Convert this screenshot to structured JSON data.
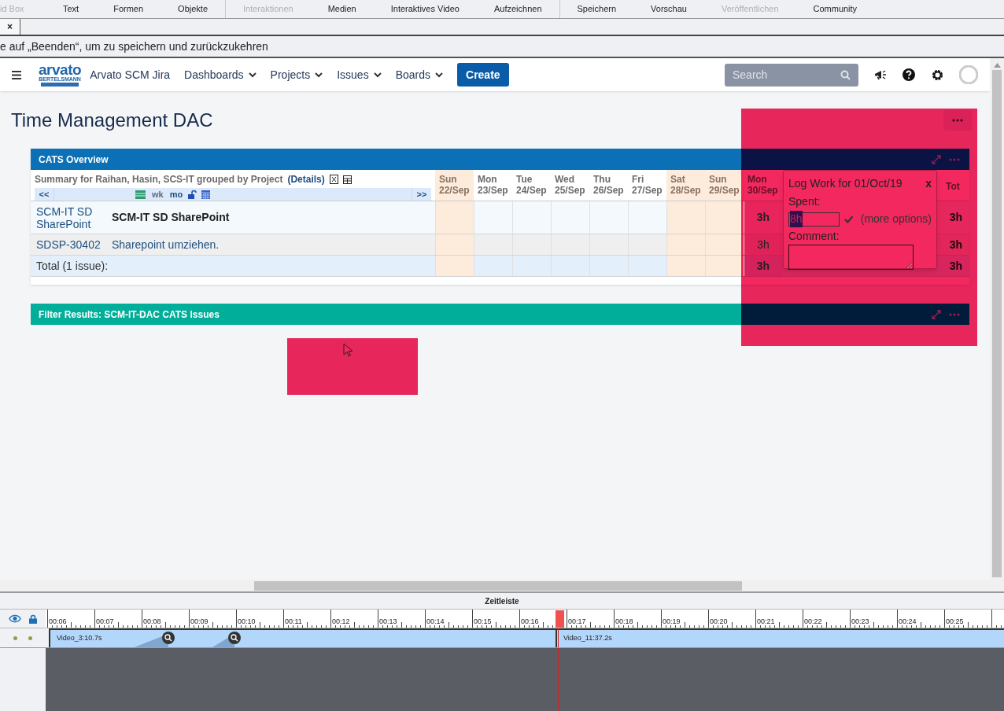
{
  "toolbar": {
    "groups": [
      [
        {
          "label": "id Box",
          "disabled": true
        },
        {
          "label": "Text",
          "disabled": false
        },
        {
          "label": "Formen",
          "disabled": false
        },
        {
          "label": "Objekte",
          "disabled": false
        }
      ],
      [
        {
          "label": "Interaktionen",
          "disabled": true
        },
        {
          "label": "Medien",
          "disabled": false
        },
        {
          "label": "Interaktives Video",
          "disabled": false
        },
        {
          "label": "Aufzeichnen",
          "disabled": false
        }
      ],
      [
        {
          "label": "Speichern",
          "disabled": false
        },
        {
          "label": "Vorschau",
          "disabled": false
        },
        {
          "label": "Veröffentlichen",
          "disabled": true
        },
        {
          "label": "Community",
          "disabled": false
        }
      ]
    ]
  },
  "document_tab": {
    "close": "×"
  },
  "message": "e auf „Beenden“, um zu speichern und zurückzukehren",
  "jira": {
    "header": {
      "logo_main": "arvato",
      "logo_sub": "BERTELSMANN",
      "site": "Arvato SCM Jira",
      "nav": [
        "Dashboards",
        "Projects",
        "Issues",
        "Boards"
      ],
      "create": "Create",
      "search_placeholder": "Search"
    },
    "page_title": "Time Management DAC",
    "cats": {
      "title": "CATS Overview",
      "summary": "Summary for Raihan, Hasin, SCS-IT grouped by Project",
      "details": "(Details)",
      "prev": "<<",
      "wk": "wk",
      "mo": "mo",
      "next": ">>",
      "days": [
        {
          "dow": "Sun",
          "date": "22/Sep",
          "weekend": true
        },
        {
          "dow": "Mon",
          "date": "23/Sep",
          "weekend": false
        },
        {
          "dow": "Tue",
          "date": "24/Sep",
          "weekend": false
        },
        {
          "dow": "Wed",
          "date": "25/Sep",
          "weekend": false
        },
        {
          "dow": "Thu",
          "date": "26/Sep",
          "weekend": false
        },
        {
          "dow": "Fri",
          "date": "27/Sep",
          "weekend": false
        },
        {
          "dow": "Sat",
          "date": "28/Sep",
          "weekend": true
        },
        {
          "dow": "Sun",
          "date": "29/Sep",
          "weekend": true
        },
        {
          "dow": "Mon",
          "date": "30/Sep",
          "weekend": false
        }
      ],
      "total_header": "Tot",
      "rows": [
        {
          "kind": "project",
          "key": "SCM-IT SD SharePoint",
          "summary": "SCM-IT SD SharePoint",
          "hours": {
            "8": "3h"
          },
          "total": "3h"
        },
        {
          "kind": "issue",
          "key": "SDSP-30402",
          "summary": "Sharepoint umziehen.",
          "hours": {
            "8": "3h"
          },
          "total": "3h"
        },
        {
          "kind": "total",
          "key": "Total (1 issue):",
          "hours": {
            "8": "3h"
          },
          "total": "3h"
        }
      ]
    },
    "popup": {
      "title": "Log Work for 01/Oct/19",
      "close": "x",
      "spent_label": "Spent:",
      "spent_value": "8h",
      "value_selected": true,
      "more": "(more options)",
      "comment_label": "Comment:"
    },
    "filter_title": "Filter Results: SCM-IT-DAC CATS Issues"
  },
  "timeline": {
    "title": "Zeitleiste",
    "ticks": [
      "00:06",
      "00:07",
      "00:08",
      "00:09",
      "00:10",
      "00:11",
      "00:12",
      "00:13",
      "00:14",
      "00:15",
      "00:16",
      "00:17",
      "00:18",
      "00:19",
      "00:20",
      "00:21",
      "00:22",
      "00:23",
      "00:24",
      "00:25"
    ],
    "clips": [
      {
        "label": "Video_3:10.7s"
      },
      {
        "label": "Video_11:37.2s"
      }
    ]
  }
}
